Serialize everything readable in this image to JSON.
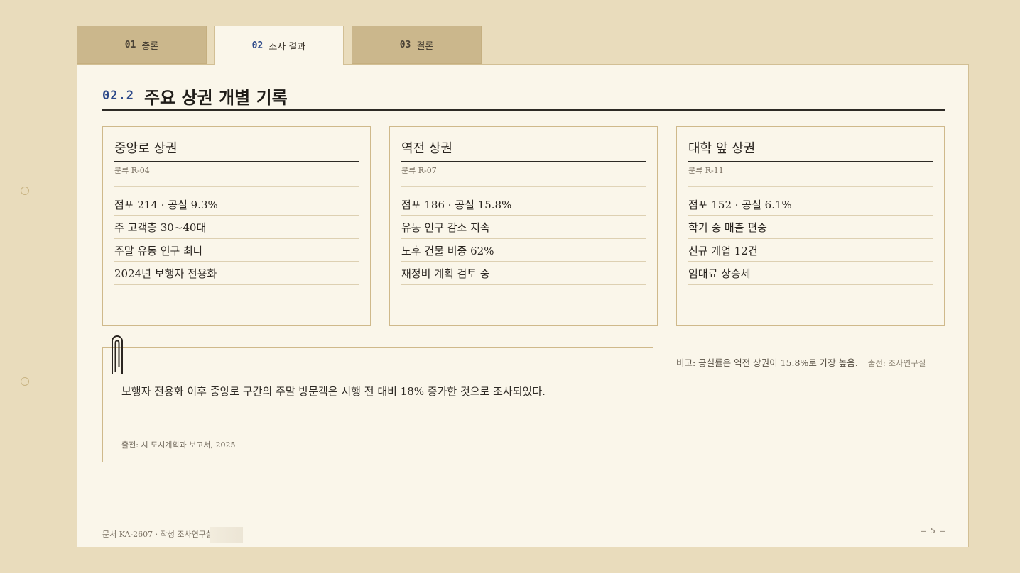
{
  "tabs": [
    {
      "num": "01",
      "label": "총론",
      "active": false
    },
    {
      "num": "02",
      "label": "조사 결과",
      "active": true
    },
    {
      "num": "03",
      "label": "결론",
      "active": false
    }
  ],
  "section": {
    "num": "02.2",
    "title": "주요 상권 개별 기록"
  },
  "cards": [
    {
      "title": "중앙로 상권",
      "code": "분류 R-04",
      "items": [
        "점포 214 · 공실 9.3%",
        "주 고객층 30~40대",
        "주말 유동 인구 최다",
        "2024년 보행자 전용화"
      ]
    },
    {
      "title": "역전 상권",
      "code": "분류 R-07",
      "items": [
        "점포 186 · 공실 15.8%",
        "유동 인구 감소 지속",
        "노후 건물 비중 62%",
        "재정비 계획 검토 중"
      ]
    },
    {
      "title": "대학 앞 상권",
      "code": "분류 R-11",
      "items": [
        "점포 152 · 공실 6.1%",
        "학기 중 매출 편중",
        "신규 개업 12건",
        "임대료 상승세"
      ]
    }
  ],
  "note": {
    "text": "보행자 전용화 이후 중앙로 구간의 주말 방문객은 시행 전 대비 18% 증가한 것으로 조사되었다.",
    "source": "출전: 시 도시계획과 보고서, 2025"
  },
  "aside": {
    "text": "비고: 공실률은 역전 상권이 15.8%로 가장 높음.",
    "source": "출전: 조사연구실"
  },
  "footer": {
    "left": "문서 KA-2607 · 작성 조사연구실",
    "page": "– 5 –"
  },
  "icons": {
    "clip": "paperclip-icon",
    "holes": "binder-hole-icon"
  },
  "colors": {
    "background": "#e9dcbc",
    "paper": "#faf6ea",
    "accent": "#2e4a8a",
    "tab": "#cbb78c",
    "border": "#cfb98b"
  }
}
